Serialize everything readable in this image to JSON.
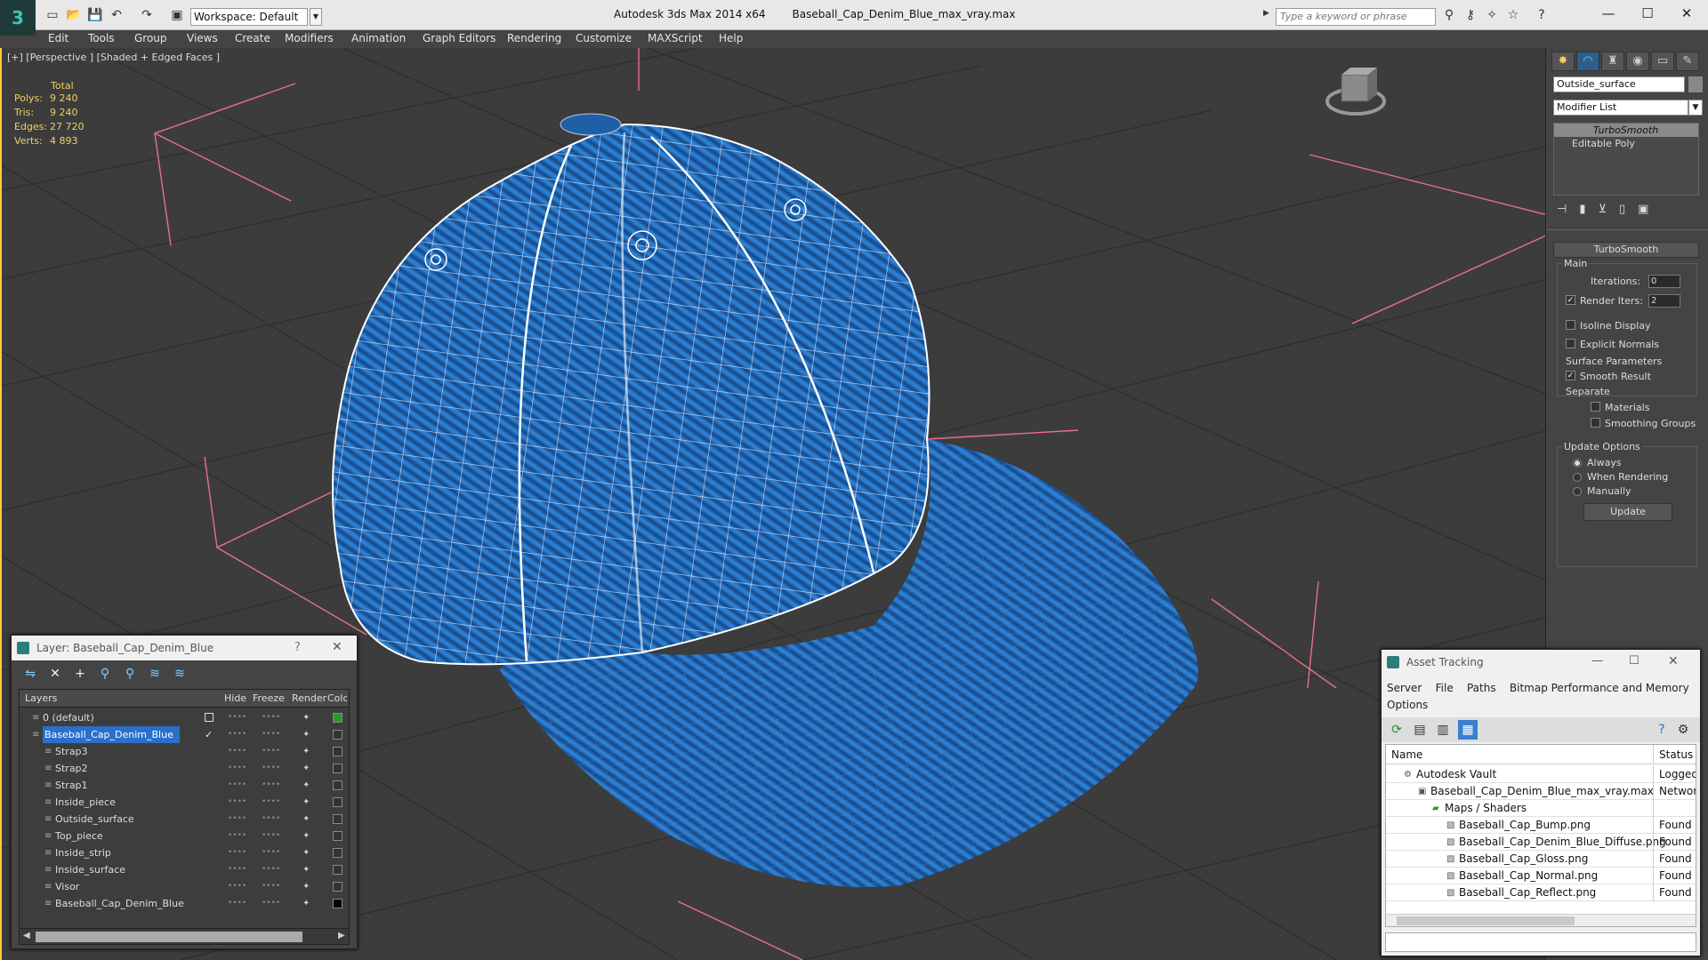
{
  "app": {
    "title": "Autodesk 3ds Max  2014 x64",
    "file": "Baseball_Cap_Denim_Blue_max_vray.max",
    "workspace": "Workspace: Default",
    "search_placeholder": "Type a keyword or phrase"
  },
  "menu": [
    "Edit",
    "Tools",
    "Group",
    "Views",
    "Create",
    "Modifiers",
    "Animation",
    "Graph Editors",
    "Rendering",
    "Customize",
    "MAXScript",
    "Help"
  ],
  "viewport": {
    "label": "[+] [Perspective ] [Shaded + Edged Faces ]",
    "stats_header": "Total",
    "stats": [
      {
        "k": "Polys:",
        "v": "9 240"
      },
      {
        "k": "Tris:",
        "v": "9 240"
      },
      {
        "k": "Edges:",
        "v": "27 720"
      },
      {
        "k": "Verts:",
        "v": "4 893"
      }
    ]
  },
  "command_panel": {
    "object_name": "Outside_surface",
    "modifier_list": "Modifier List",
    "stack": [
      "TurboSmooth",
      "Editable Poly"
    ],
    "rollout_title": "TurboSmooth",
    "main_label": "Main",
    "iterations_label": "Iterations:",
    "iterations": "0",
    "render_iters_label": "Render Iters:",
    "render_iters": "2",
    "isoline": "Isoline Display",
    "explicit": "Explicit Normals",
    "surface_params": "Surface Parameters",
    "smooth_result": "Smooth Result",
    "separate": "Separate",
    "materials": "Materials",
    "smoothing_groups": "Smoothing Groups",
    "update_options": "Update Options",
    "always": "Always",
    "when_rendering": "When Rendering",
    "manually": "Manually",
    "update_btn": "Update"
  },
  "layer_window": {
    "title": "Layer: Baseball_Cap_Denim_Blue",
    "help": "?",
    "columns": [
      "Layers",
      "Hide",
      "Freeze",
      "Render",
      "Color"
    ],
    "rows": [
      {
        "name": "0 (default)",
        "indent": 0,
        "color": "#2a9a2a"
      },
      {
        "name": "Baseball_Cap_Denim_Blue",
        "indent": 0,
        "selected": true,
        "color": "#333"
      },
      {
        "name": "Strap3",
        "indent": 1,
        "color": "#333"
      },
      {
        "name": "Strap2",
        "indent": 1,
        "color": "#333"
      },
      {
        "name": "Strap1",
        "indent": 1,
        "color": "#333"
      },
      {
        "name": "Inside_piece",
        "indent": 1,
        "color": "#333"
      },
      {
        "name": "Outside_surface",
        "indent": 1,
        "color": "#333"
      },
      {
        "name": "Top_piece",
        "indent": 1,
        "color": "#333"
      },
      {
        "name": "Inside_strip",
        "indent": 1,
        "color": "#333"
      },
      {
        "name": "Inside_surface",
        "indent": 1,
        "color": "#333"
      },
      {
        "name": "Visor",
        "indent": 1,
        "color": "#333"
      },
      {
        "name": "Baseball_Cap_Denim_Blue",
        "indent": 1,
        "color": "#000"
      }
    ]
  },
  "asset_window": {
    "title": "Asset Tracking",
    "menu": [
      "Server",
      "File",
      "Paths",
      "Bitmap Performance and Memory",
      "Options"
    ],
    "columns": [
      "Name",
      "Status"
    ],
    "rows": [
      {
        "name": "Autodesk Vault",
        "status": "Logged O",
        "indent": 0
      },
      {
        "name": "Baseball_Cap_Denim_Blue_max_vray.max",
        "status": "Network",
        "indent": 1
      },
      {
        "name": "Maps / Shaders",
        "status": "",
        "indent": 2
      },
      {
        "name": "Baseball_Cap_Bump.png",
        "status": "Found",
        "indent": 3
      },
      {
        "name": "Baseball_Cap_Denim_Blue_Diffuse.png",
        "status": "Found",
        "indent": 3
      },
      {
        "name": "Baseball_Cap_Gloss.png",
        "status": "Found",
        "indent": 3
      },
      {
        "name": "Baseball_Cap_Normal.png",
        "status": "Found",
        "indent": 3
      },
      {
        "name": "Baseball_Cap_Reflect.png",
        "status": "Found",
        "indent": 3
      }
    ]
  },
  "colors": {
    "accent": "#ffcc33",
    "selection": "#2a6fc9",
    "denim": "#1f5fa8"
  }
}
